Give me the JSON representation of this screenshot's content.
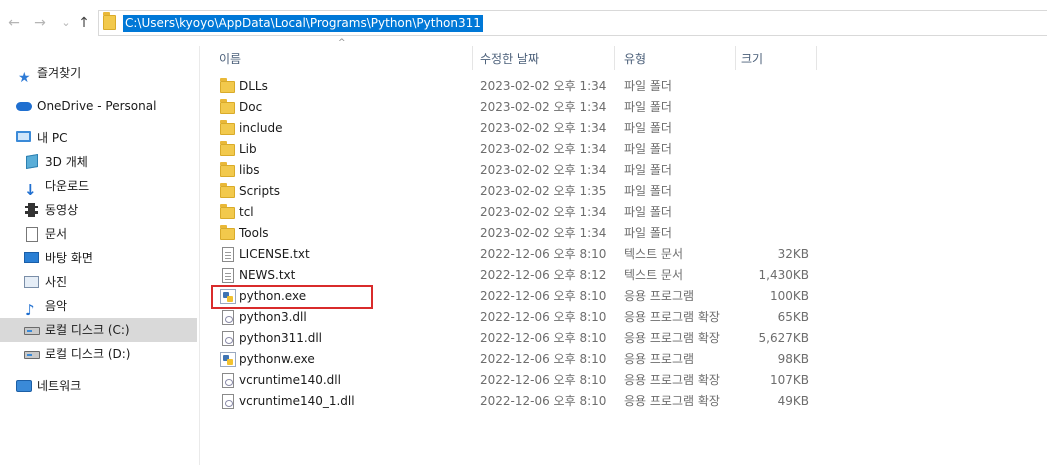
{
  "address_bar": {
    "path": "C:\\Users\\kyoyo\\AppData\\Local\\Programs\\Python\\Python311",
    "back_glyph": "←",
    "forward_glyph": "→",
    "recent_glyph": "⌄",
    "up_glyph": "↑"
  },
  "nav_pane": {
    "items": [
      {
        "label": "즐겨찾기",
        "icon": "star-icon"
      },
      {
        "label": "OneDrive - Personal",
        "icon": "cloud-icon"
      },
      {
        "label": "내 PC",
        "icon": "pc-icon"
      },
      {
        "label": "3D 개체",
        "icon": "cube-icon"
      },
      {
        "label": "다운로드",
        "icon": "download-icon"
      },
      {
        "label": "동영상",
        "icon": "video-icon"
      },
      {
        "label": "문서",
        "icon": "document-icon"
      },
      {
        "label": "바탕 화면",
        "icon": "desktop-icon"
      },
      {
        "label": "사진",
        "icon": "picture-icon"
      },
      {
        "label": "음악",
        "icon": "music-icon"
      },
      {
        "label": "로컬 디스크 (C:)",
        "icon": "drive-icon",
        "selected": true
      },
      {
        "label": "로컬 디스크 (D:)",
        "icon": "drive-icon"
      },
      {
        "label": "네트워크",
        "icon": "network-icon"
      }
    ]
  },
  "columns": {
    "name": "이름",
    "date": "수정한 날짜",
    "type": "유형",
    "size": "크기"
  },
  "files": [
    {
      "name": "DLLs",
      "date": "2023-02-02 오후 1:34",
      "type": "파일 폴더",
      "size": "",
      "icon": "folder-icon"
    },
    {
      "name": "Doc",
      "date": "2023-02-02 오후 1:34",
      "type": "파일 폴더",
      "size": "",
      "icon": "folder-icon"
    },
    {
      "name": "include",
      "date": "2023-02-02 오후 1:34",
      "type": "파일 폴더",
      "size": "",
      "icon": "folder-icon"
    },
    {
      "name": "Lib",
      "date": "2023-02-02 오후 1:34",
      "type": "파일 폴더",
      "size": "",
      "icon": "folder-icon"
    },
    {
      "name": "libs",
      "date": "2023-02-02 오후 1:34",
      "type": "파일 폴더",
      "size": "",
      "icon": "folder-icon"
    },
    {
      "name": "Scripts",
      "date": "2023-02-02 오후 1:35",
      "type": "파일 폴더",
      "size": "",
      "icon": "folder-icon"
    },
    {
      "name": "tcl",
      "date": "2023-02-02 오후 1:34",
      "type": "파일 폴더",
      "size": "",
      "icon": "folder-icon"
    },
    {
      "name": "Tools",
      "date": "2023-02-02 오후 1:34",
      "type": "파일 폴더",
      "size": "",
      "icon": "folder-icon"
    },
    {
      "name": "LICENSE.txt",
      "date": "2022-12-06 오후 8:10",
      "type": "텍스트 문서",
      "size": "32KB",
      "icon": "text-file-icon"
    },
    {
      "name": "NEWS.txt",
      "date": "2022-12-06 오후 8:12",
      "type": "텍스트 문서",
      "size": "1,430KB",
      "icon": "text-file-icon"
    },
    {
      "name": "python.exe",
      "date": "2022-12-06 오후 8:10",
      "type": "응용 프로그램",
      "size": "100KB",
      "icon": "python-exe-icon"
    },
    {
      "name": "python3.dll",
      "date": "2022-12-06 오후 8:10",
      "type": "응용 프로그램 확장",
      "size": "65KB",
      "icon": "dll-file-icon"
    },
    {
      "name": "python311.dll",
      "date": "2022-12-06 오후 8:10",
      "type": "응용 프로그램 확장",
      "size": "5,627KB",
      "icon": "dll-file-icon"
    },
    {
      "name": "pythonw.exe",
      "date": "2022-12-06 오후 8:10",
      "type": "응용 프로그램",
      "size": "98KB",
      "icon": "python-exe-icon"
    },
    {
      "name": "vcruntime140.dll",
      "date": "2022-12-06 오후 8:10",
      "type": "응용 프로그램 확장",
      "size": "107KB",
      "icon": "dll-file-icon"
    },
    {
      "name": "vcruntime140_1.dll",
      "date": "2022-12-06 오후 8:10",
      "type": "응용 프로그램 확장",
      "size": "49KB",
      "icon": "dll-file-icon"
    }
  ],
  "colors": {
    "selection": "#0078d7",
    "highlight_box": "#d92b2b",
    "nav_selected": "#d9d9d9"
  }
}
